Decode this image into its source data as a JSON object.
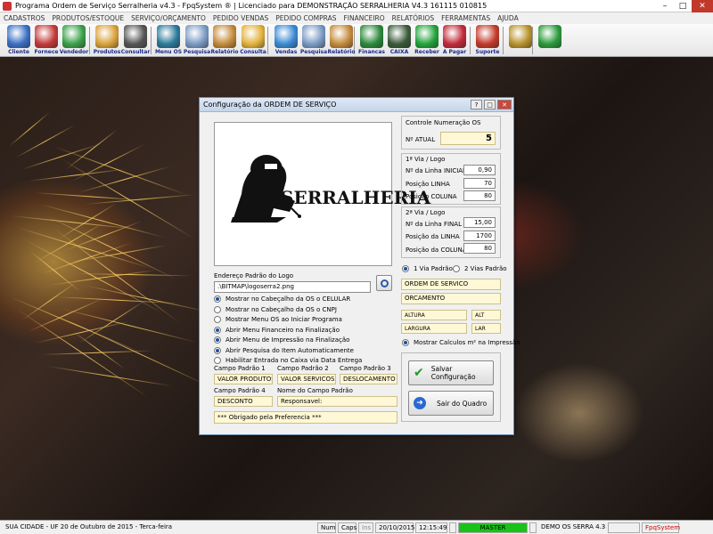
{
  "window": {
    "title": "Programa Ordem de Serviço Serralheria v4.3 - FpqSystem ® | Licenciado para  DEMONSTRAÇÃO SERRALHERIA V4.3 161115 010815"
  },
  "menu": [
    "CADASTROS",
    "PRODUTOS/ESTOQUE",
    "SERVIÇO/ORÇAMENTO",
    "PEDIDO VENDAS",
    "PEDIDO COMPRAS",
    "FINANCEIRO",
    "RELATÓRIOS",
    "FERRAMENTAS",
    "AJUDA"
  ],
  "toolbar": [
    {
      "label": "Cliente",
      "icon": "client-icon",
      "color": "#3a6fc4"
    },
    {
      "label": "Fornece",
      "icon": "supplier-icon",
      "color": "#c43a3a"
    },
    {
      "label": "Vendedor",
      "icon": "seller-icon",
      "color": "#3aa04a"
    },
    {
      "label": "Produtos",
      "icon": "products-icon",
      "color": "#d9a23a"
    },
    {
      "label": "Consultar",
      "icon": "barcode-icon",
      "color": "#555555"
    },
    {
      "label": "Menu OS",
      "icon": "service-order-icon",
      "color": "#2a7a9a"
    },
    {
      "label": "Pesquisa",
      "icon": "search-doc-icon",
      "color": "#7a9ac4"
    },
    {
      "label": "Relatório",
      "icon": "report-icon",
      "color": "#c48a3a"
    },
    {
      "label": "Consulta",
      "icon": "folder-icon",
      "color": "#e2b23a"
    },
    {
      "label": "Vendas",
      "icon": "monitor-icon",
      "color": "#3a8ad4"
    },
    {
      "label": "Pesquisa",
      "icon": "search-doc-icon",
      "color": "#7a9ac4"
    },
    {
      "label": "Relatório",
      "icon": "report-icon",
      "color": "#c48a3a"
    },
    {
      "label": "Financas",
      "icon": "finance-icon",
      "color": "#2a8a3a"
    },
    {
      "label": "CAIXA",
      "icon": "cashbox-icon",
      "color": "#3a5a3a"
    },
    {
      "label": "Receber",
      "icon": "receive-money-icon",
      "color": "#22a33a"
    },
    {
      "label": "A Pagar",
      "icon": "pay-money-icon",
      "color": "#c22a3a"
    },
    {
      "label": "Suporte",
      "icon": "support-icon",
      "color": "#c43a2a"
    },
    {
      "label": "",
      "icon": "coins-icon",
      "color": "#b8922a"
    },
    {
      "label": "",
      "icon": "exit-icon",
      "color": "#2a9a3a"
    }
  ],
  "dialog": {
    "title": "Configuração da ORDEM DE SERVIÇO",
    "logo_text": "SERRALHERIA",
    "logo_path_label": "Endereço Padrão do Logo",
    "logo_path_value": ".\\BITMAP\\logoserra2.png",
    "options": [
      {
        "label": "Mostrar no Cabeçalho da OS o CELULAR",
        "checked": true
      },
      {
        "label": "Mostrar no Cabeçalho da OS o CNPJ",
        "checked": false
      },
      {
        "label": "Mostrar Menu OS ao Iniciar Programa",
        "checked": false
      },
      {
        "label": "Abrir Menu Financeiro na Finalização",
        "checked": true
      },
      {
        "label": "Abrir Menu de Impressão na Finalização",
        "checked": true
      },
      {
        "label": "Abrir Pesquisa do Item Automaticamente",
        "checked": true
      },
      {
        "label": "Habilitar Entrada no Caixa via Data Entrega",
        "checked": false
      }
    ],
    "campo1_label": "Campo Padrão 1",
    "campo1_value": "VALOR PRODUTOS",
    "campo2_label": "Campo Padrão 2",
    "campo2_value": "VALOR SERVICOS",
    "campo3_label": "Campo Padrão 3",
    "campo3_value": "DESLOCAMENTO",
    "campo4_label": "Campo Padrão 4",
    "campo4_value": "DESCONTO",
    "nome_campo_label": "Nome do Campo Padrão",
    "nome_campo_value": "Responsavel:",
    "footer_text": "*** Obrigado pela Preferencia ***",
    "controle_label": "Controle Numeração OS",
    "n_atual_label": "Nº ATUAL",
    "n_atual_value": "5",
    "via1_label": "1ª Via / Logo",
    "via1_linha_label": "Nº da Linha INICIAL",
    "via1_linha_value": "0,90",
    "via1_posl_label": "Posição LINHA",
    "via1_posl_value": "70",
    "via1_posc_label": "Posição COLUNA",
    "via1_posc_value": "80",
    "via2_label": "2ª Via / Logo",
    "via2_linha_label": "Nº da Linha FINAL",
    "via2_linha_value": "15,00",
    "via2_posl_label": "Posição da LINHA",
    "via2_posl_value": "1700",
    "via2_posc_label": "Posição da COLUNA",
    "via2_posc_value": "80",
    "via_padrao_label": "1 Via Padrão",
    "duas_vias_label": "2 Vias Padrão",
    "titulo_os": "ORDEM DE SERVICO",
    "titulo_orc": "ORCAMENTO",
    "altura_label": "ALTURA",
    "altura_abbr": "ALT",
    "largura_label": "LARGURA",
    "largura_abbr": "LAR",
    "calc_label": "Mostrar Calculos m² na Impressão",
    "save_label": "Salvar Configuração",
    "exit_label": "Sair do Quadro"
  },
  "status": {
    "city": "SUA CIDADE - UF 20 de Outubro de 2015 - Terca-feira",
    "num": "Num",
    "caps": "Caps",
    "ins": "Ins",
    "date": "20/10/2015",
    "time": "12:15:49",
    "master": "MASTER",
    "demo": "DEMO OS SERRA 4.3",
    "brand": "FpqSystem"
  },
  "colors": {
    "accent": "#1c4fa0",
    "field_bg": "#fff8d6",
    "status_green": "#19c219"
  }
}
